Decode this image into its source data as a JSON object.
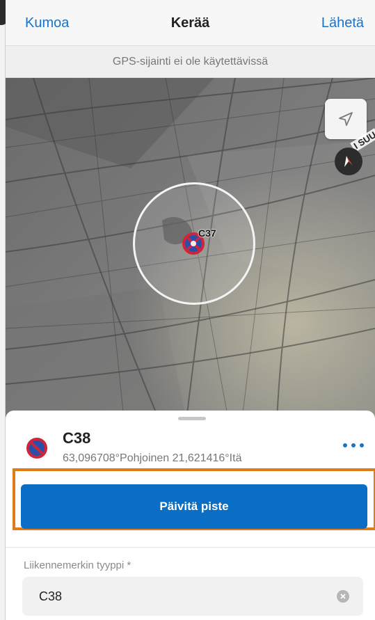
{
  "nav": {
    "cancel_label": "Kumoa",
    "title": "Kerää",
    "submit_label": "Lähetä"
  },
  "gps_status": "GPS-sijainti ei ole käytettävissä",
  "map": {
    "road_label": "I SUU",
    "marker_label": "C37",
    "icons": {
      "locate": "location-arrow-icon",
      "compass": "compass-icon",
      "marker": "no-parking-sign-icon"
    }
  },
  "feature": {
    "title": "C38",
    "coordinates": "63,096708°Pohjoinen  21,621416°Itä",
    "icon": "no-parking-sign-icon"
  },
  "update_button_label": "Päivitä piste",
  "field": {
    "label": "Liikennemerkin tyyppi *",
    "value": "C38"
  },
  "colors": {
    "accent": "#1a73c8",
    "button": "#0a6fc4",
    "highlight": "#e07b1a",
    "sign_red": "#d0243a",
    "sign_blue": "#2a4fa8"
  }
}
